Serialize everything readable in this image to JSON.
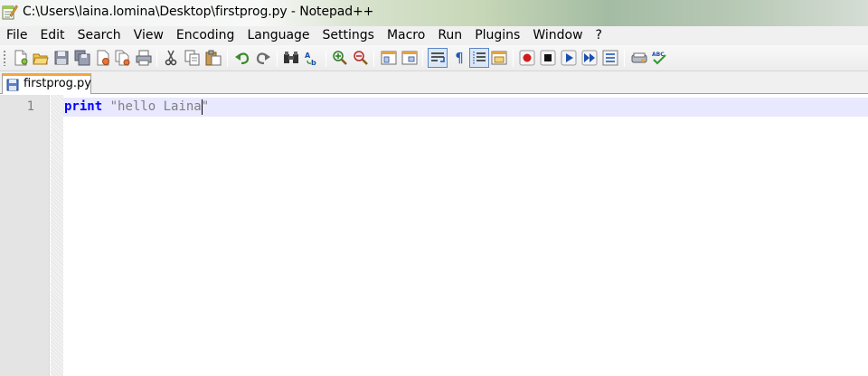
{
  "window": {
    "title": "C:\\Users\\laina.lomina\\Desktop\\firstprog.py - Notepad++",
    "app_icon": "notepadpp-icon"
  },
  "menu": {
    "items": [
      "File",
      "Edit",
      "Search",
      "View",
      "Encoding",
      "Language",
      "Settings",
      "Macro",
      "Run",
      "Plugins",
      "Window",
      "?"
    ]
  },
  "toolbar": {
    "buttons": [
      "new-file-icon",
      "open-file-icon",
      "save-icon",
      "save-all-icon",
      "close-icon",
      "close-all-icon",
      "print-icon",
      "cut-icon",
      "copy-icon",
      "paste-icon",
      "undo-icon",
      "redo-icon",
      "find-icon",
      "replace-icon",
      "zoom-in-icon",
      "zoom-out-icon",
      "sync-vertical-icon",
      "sync-horizontal-icon",
      "word-wrap-icon",
      "show-all-characters-icon",
      "indent-guide-icon",
      "language-panel-icon",
      "record-macro-icon",
      "stop-recording-icon",
      "play-macro-icon",
      "run-macro-multiple-icon",
      "save-macro-icon",
      "run-icon",
      "spell-check-icon"
    ],
    "active_toggles": [
      "word-wrap-icon",
      "indent-guide-icon"
    ]
  },
  "tabs": [
    {
      "label": "firstprog.py",
      "icon": "file-saved-icon",
      "active": true
    }
  ],
  "editor": {
    "lines": [
      {
        "number": "1",
        "keyword": "print",
        "space": " ",
        "string_before_caret": "\"hello Laina",
        "string_after_caret": "\""
      }
    ],
    "colors": {
      "keyword": "#0000ff",
      "string": "#808080",
      "current_line": "#e8e8ff",
      "gutter": "#e4e4e4"
    }
  }
}
